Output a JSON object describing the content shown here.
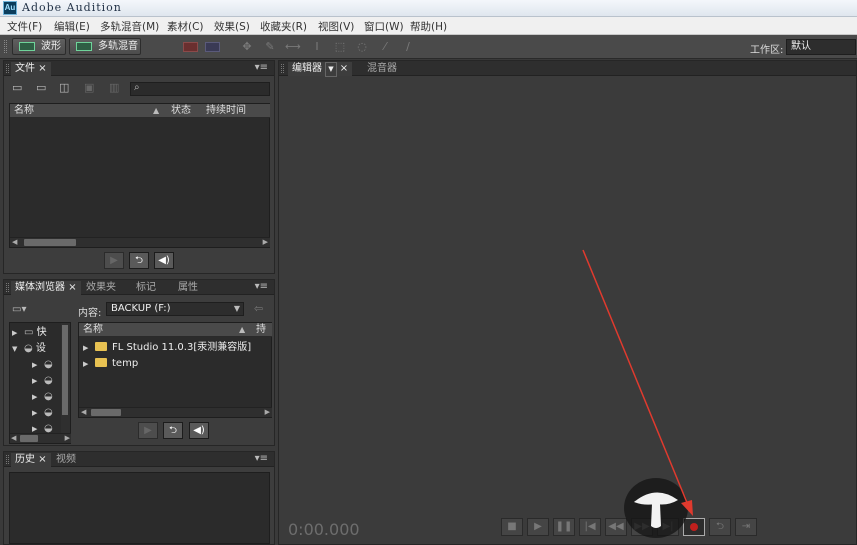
{
  "app": {
    "logo": "Au",
    "title": "Adobe Audition"
  },
  "menu": [
    "文件(F)",
    "编辑(E)",
    "多轨混音(M)",
    "素材(C)",
    "效果(S)",
    "收藏夹(R)",
    "视图(V)",
    "窗口(W)",
    "帮助(H)"
  ],
  "toolbar": {
    "waveform_label": "波形",
    "multitrack_label": "多轨混音",
    "workspace_label": "工作区:",
    "workspace_value": "默认"
  },
  "files_panel": {
    "tab": "文件",
    "columns": [
      "名称",
      "状态",
      "持续时间"
    ]
  },
  "media_panel": {
    "tabs": [
      "媒体浏览器",
      "效果夹",
      "标记",
      "属性"
    ],
    "content_label": "内容:",
    "content_value": "BACKUP (F:)",
    "tree": [
      "快",
      "设"
    ],
    "list_header": "名称",
    "list_header2": "持",
    "items": [
      "FL Studio 11.0.3[汞测兼容版]",
      "temp"
    ]
  },
  "history_panel": {
    "tabs": [
      "历史",
      "视频"
    ]
  },
  "editor": {
    "tabs": [
      "编辑器",
      "混音器"
    ],
    "time": "0:00.000"
  },
  "colors": {
    "record": "#c0201d",
    "annotation_arrow": "#e03a2e",
    "folder": "#e8c252"
  }
}
